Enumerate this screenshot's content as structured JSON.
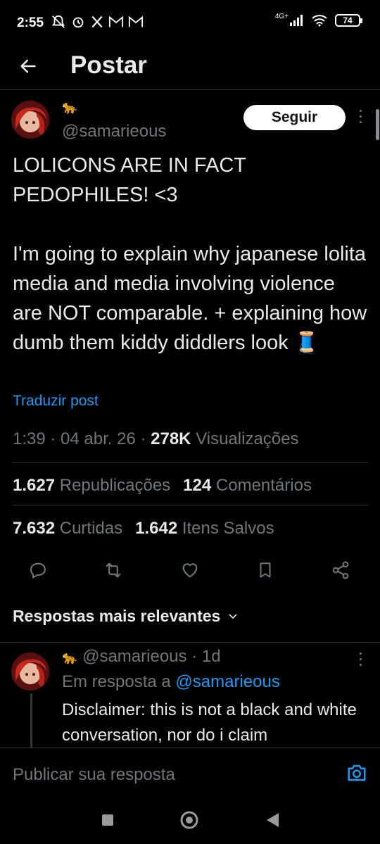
{
  "status_bar": {
    "time": "2:55",
    "network": "4G+",
    "battery": "74"
  },
  "header": {
    "title": "Postar"
  },
  "post": {
    "author_emoji": "🐆",
    "handle": "@samarieous",
    "follow_label": "Seguir",
    "text": "LOLICONS ARE IN FACT\nPEDOPHILES! <3\n\nI'm going to explain why japanese lolita media and media involving violence are NOT comparable. + explaining how dumb them kiddy diddlers look 🧵",
    "translate_label": "Traduzir post",
    "time": "1:39",
    "date": "04 abr. 26",
    "views_count": "278K",
    "views_label": "Visualizações",
    "reposts_count": "1.627",
    "reposts_label": "Republicações",
    "comments_count": "124",
    "comments_label": "Comentários",
    "likes_count": "7.632",
    "likes_label": "Curtidas",
    "saves_count": "1.642",
    "saves_label": "Itens Salvos"
  },
  "replies": {
    "header": "Respostas mais relevantes",
    "items": [
      {
        "emoji": "🐆",
        "handle": "@samarieous",
        "age": "1d",
        "in_reply_prefix": "Em resposta a",
        "in_reply_handle": "@samarieous",
        "text": "Disclaimer: this is not a black and white conversation, nor do i claim"
      }
    ]
  },
  "compose": {
    "placeholder": "Publicar sua resposta"
  },
  "colors": {
    "background": "#000000",
    "text": "#e7e9ea",
    "muted": "#71767b",
    "accent": "#1d9bf0",
    "divider": "#2f3336"
  },
  "icons": {
    "back": "arrow-left-icon",
    "reply": "reply-icon",
    "repost": "repost-icon",
    "like": "heart-icon",
    "bookmark": "bookmark-icon",
    "share": "share-icon",
    "camera": "camera-icon",
    "more": "more-vertical-icon"
  }
}
